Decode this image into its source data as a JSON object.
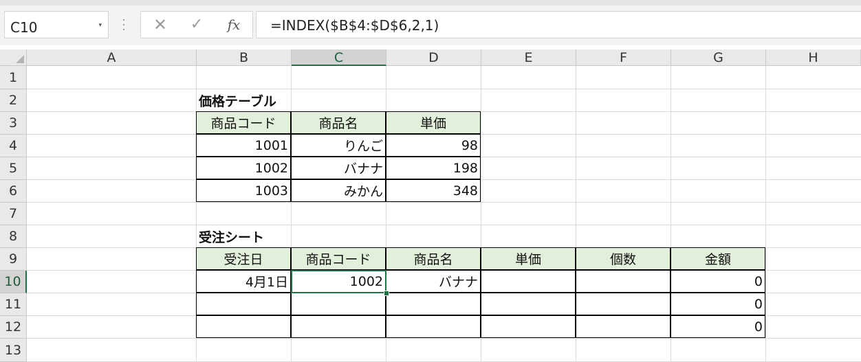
{
  "namebox": {
    "value": "C10",
    "dropdown": "▾"
  },
  "formula_bar": {
    "cancel_icon": "✕",
    "enter_icon": "✓",
    "fx_label": "fx",
    "formula": "=INDEX($B$4:$D$6,2,1)"
  },
  "selected_cell": "C10",
  "columns": [
    "A",
    "B",
    "C",
    "D",
    "E",
    "F",
    "G",
    "H"
  ],
  "rows": [
    "1",
    "2",
    "3",
    "4",
    "5",
    "6",
    "7",
    "8",
    "9",
    "10",
    "11",
    "12",
    "13"
  ],
  "price_table": {
    "title": "価格テーブル",
    "headers": [
      "商品コード",
      "商品名",
      "単価"
    ],
    "rows": [
      [
        "1001",
        "りんご",
        "98"
      ],
      [
        "1002",
        "バナナ",
        "198"
      ],
      [
        "1003",
        "みかん",
        "348"
      ]
    ]
  },
  "order_sheet": {
    "title": "受注シート",
    "headers": [
      "受注日",
      "商品コード",
      "商品名",
      "単価",
      "個数",
      "金額"
    ],
    "rows": [
      [
        "4月1日",
        "1002",
        "バナナ",
        "",
        "",
        "0"
      ],
      [
        "",
        "",
        "",
        "",
        "",
        "0"
      ],
      [
        "",
        "",
        "",
        "",
        "",
        "0"
      ]
    ]
  },
  "colors": {
    "selection": "#217346",
    "header_fill": "#e2efda",
    "gridline": "#d9d9d9"
  }
}
